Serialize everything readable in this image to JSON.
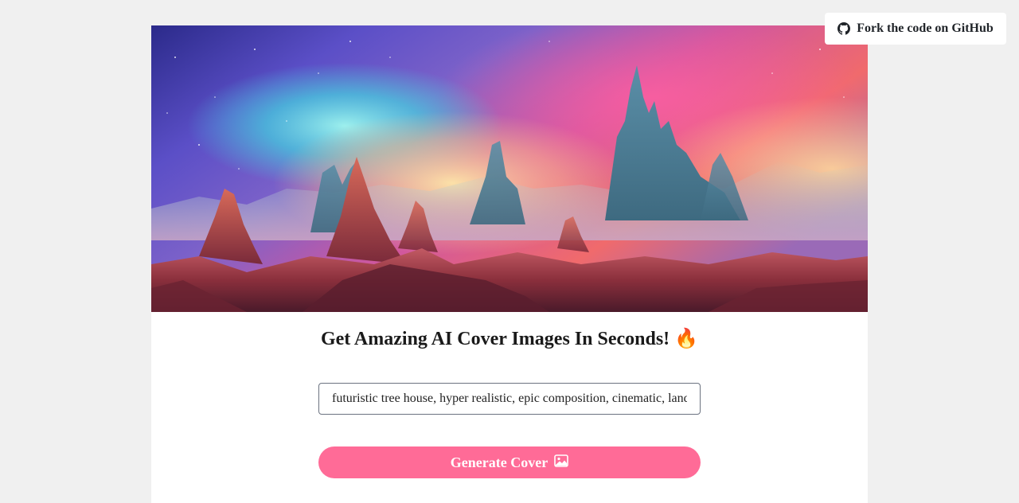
{
  "github": {
    "label": "Fork the code on GitHub",
    "icon": "github-icon"
  },
  "hero": {
    "alt": "Alien mountain landscape under a colorful nebula sky"
  },
  "headline": {
    "text": "Get Amazing AI Cover Images In Seconds!",
    "emoji": "🔥"
  },
  "prompt": {
    "value": "futuristic tree house, hyper realistic, epic composition, cinematic, landscape"
  },
  "generate": {
    "label": "Generate Cover",
    "icon": "image-icon"
  },
  "colors": {
    "background": "#f0f0f0",
    "accent": "#ff6b97",
    "card": "#ffffff"
  }
}
